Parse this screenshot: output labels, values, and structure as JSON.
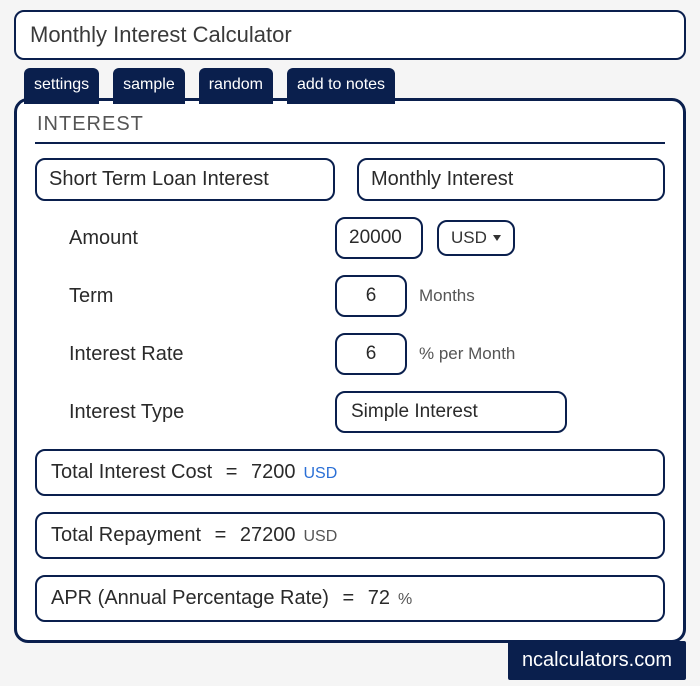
{
  "title": "Monthly Interest Calculator",
  "tabs": {
    "settings": "settings",
    "sample": "sample",
    "random": "random",
    "add_to_notes": "add to notes"
  },
  "panel": {
    "heading": "INTEREST",
    "left_section": "Short Term Loan Interest",
    "right_section": "Monthly Interest"
  },
  "form": {
    "amount_label": "Amount",
    "amount_value": "20000",
    "currency": "USD",
    "term_label": "Term",
    "term_value": "6",
    "term_unit": "Months",
    "rate_label": "Interest Rate",
    "rate_value": "6",
    "rate_unit": "% per Month",
    "type_label": "Interest Type",
    "type_value": "Simple Interest"
  },
  "results": {
    "interest_cost_label": "Total Interest Cost",
    "interest_cost_value": "7200",
    "interest_cost_unit": "USD",
    "repayment_label": "Total Repayment",
    "repayment_value": "27200",
    "repayment_unit": "USD",
    "apr_label": "APR (Annual Percentage Rate)",
    "apr_value": "72",
    "apr_unit": "%"
  },
  "brand": "ncalculators.com"
}
